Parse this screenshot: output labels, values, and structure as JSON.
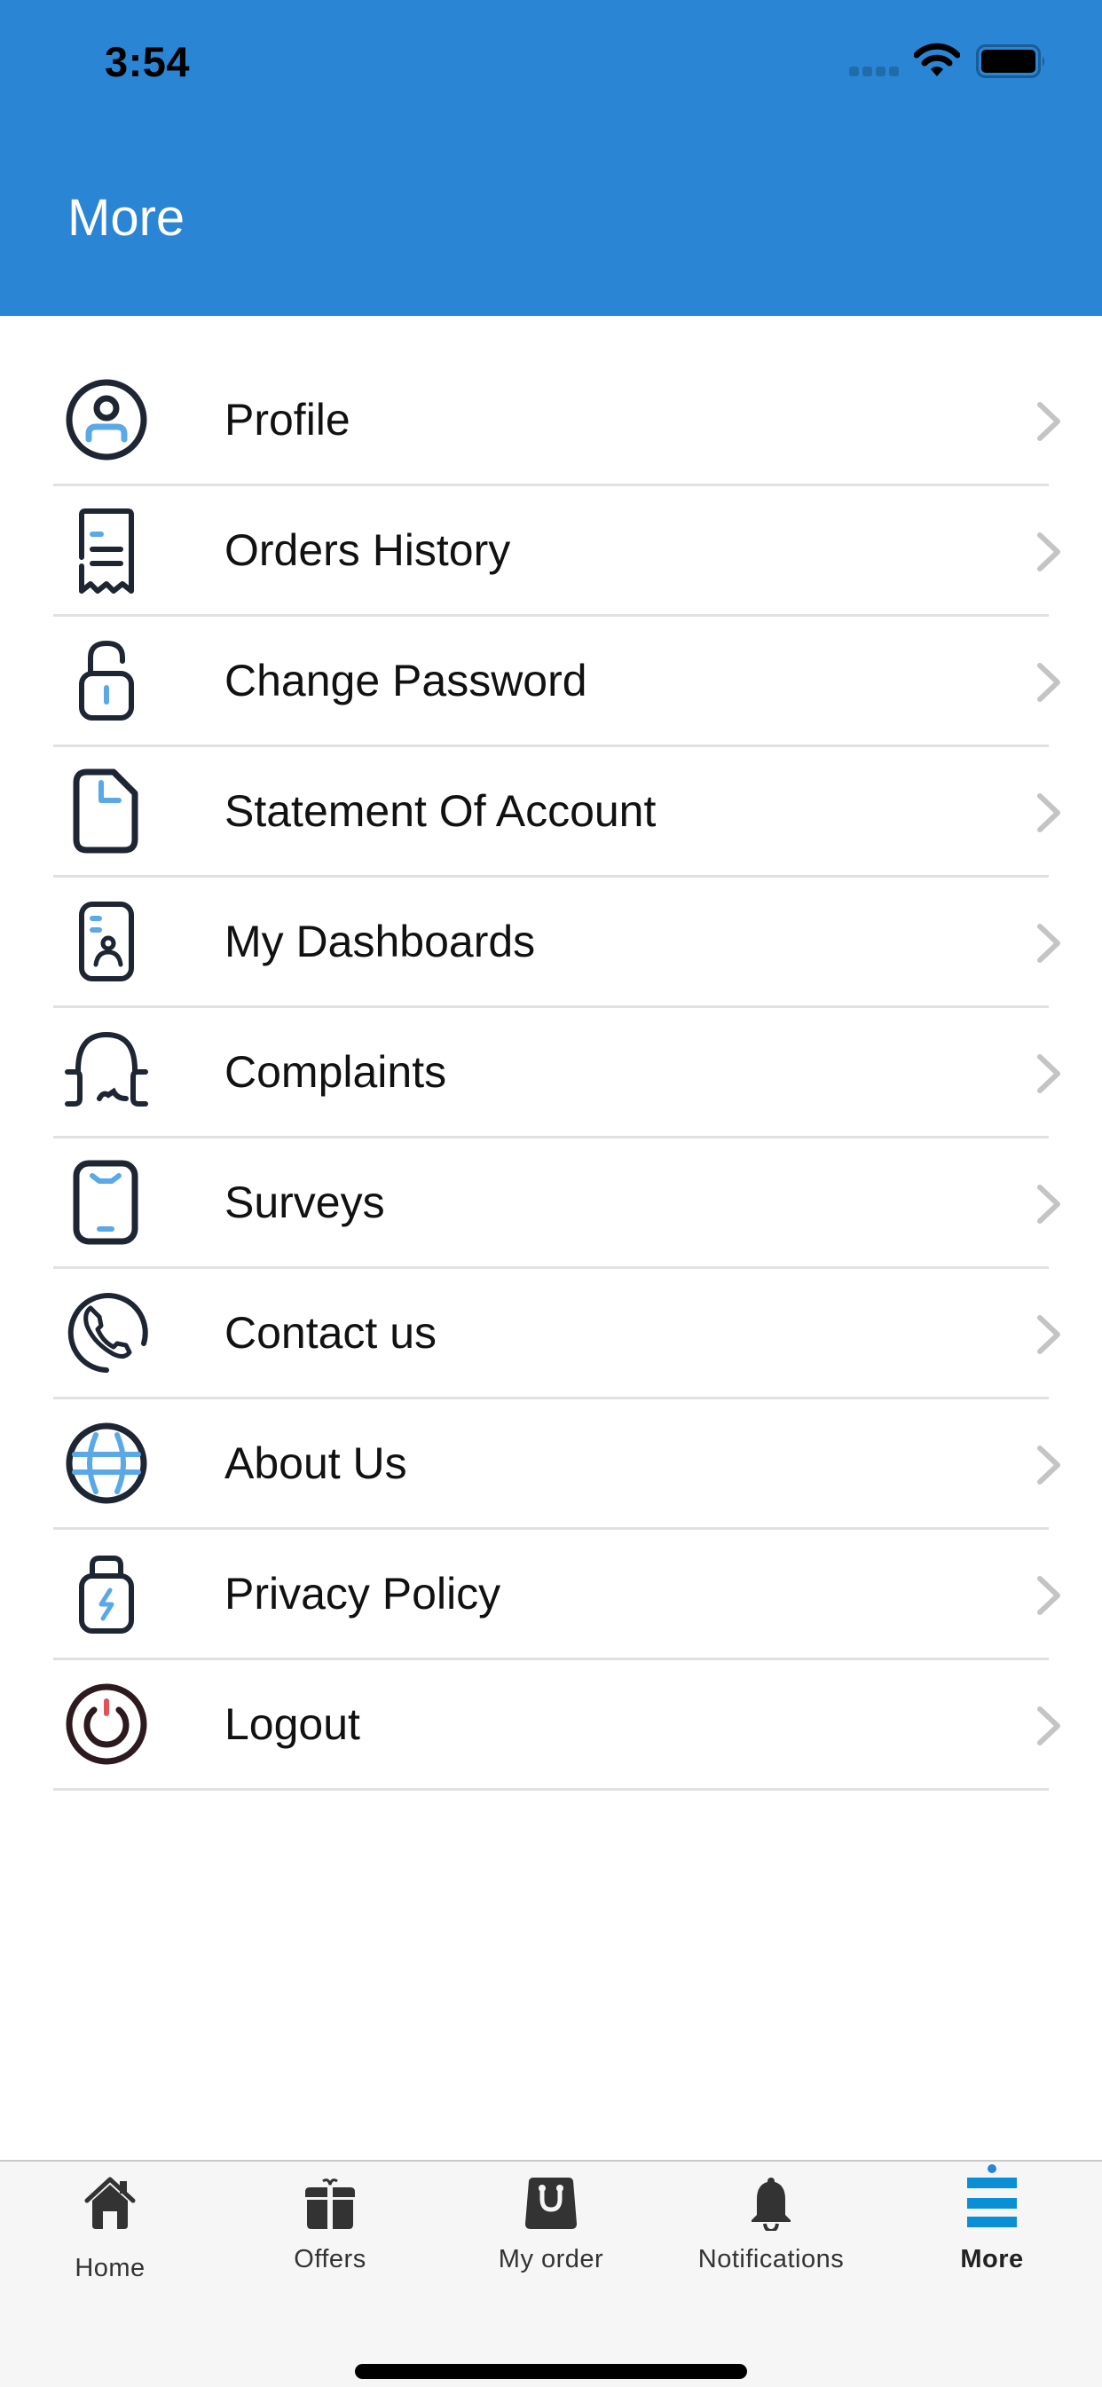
{
  "status_bar": {
    "time": "3:54",
    "signal_icon": "cellular-signal-icon",
    "wifi_icon": "wifi-icon",
    "battery_icon": "battery-icon"
  },
  "header": {
    "title": "More",
    "background_color": "#2a85d4"
  },
  "menu": {
    "items": [
      {
        "label": "Profile",
        "icon": "profile-icon"
      },
      {
        "label": "Orders History",
        "icon": "receipt-icon"
      },
      {
        "label": "Change Password",
        "icon": "unlock-icon"
      },
      {
        "label": "Statement Of Account",
        "icon": "document-icon"
      },
      {
        "label": "My Dashboards",
        "icon": "id-card-icon"
      },
      {
        "label": "Complaints",
        "icon": "headset-icon"
      },
      {
        "label": "Surveys",
        "icon": "phone-device-icon"
      },
      {
        "label": "Contact us",
        "icon": "phone-call-icon"
      },
      {
        "label": "About Us",
        "icon": "globe-icon"
      },
      {
        "label": "Privacy Policy",
        "icon": "lock-bolt-icon"
      },
      {
        "label": "Logout",
        "icon": "power-icon"
      }
    ],
    "chevron_icon": "chevron-right-icon"
  },
  "tabbar": {
    "tabs": [
      {
        "label": "Home",
        "icon": "home-icon",
        "active": false
      },
      {
        "label": "Offers",
        "icon": "gift-icon",
        "active": false
      },
      {
        "label": "My order",
        "icon": "shopping-bag-icon",
        "active": false
      },
      {
        "label": "Notifications",
        "icon": "bell-icon",
        "active": false
      },
      {
        "label": "More",
        "icon": "menu-icon",
        "active": true
      }
    ],
    "active_color": "#0a8fd6"
  },
  "colors": {
    "icon_dark": "#1e2533",
    "icon_accent": "#5aa9e6",
    "logout_accent": "#e0525a",
    "chevron": "#c4c4c4"
  }
}
